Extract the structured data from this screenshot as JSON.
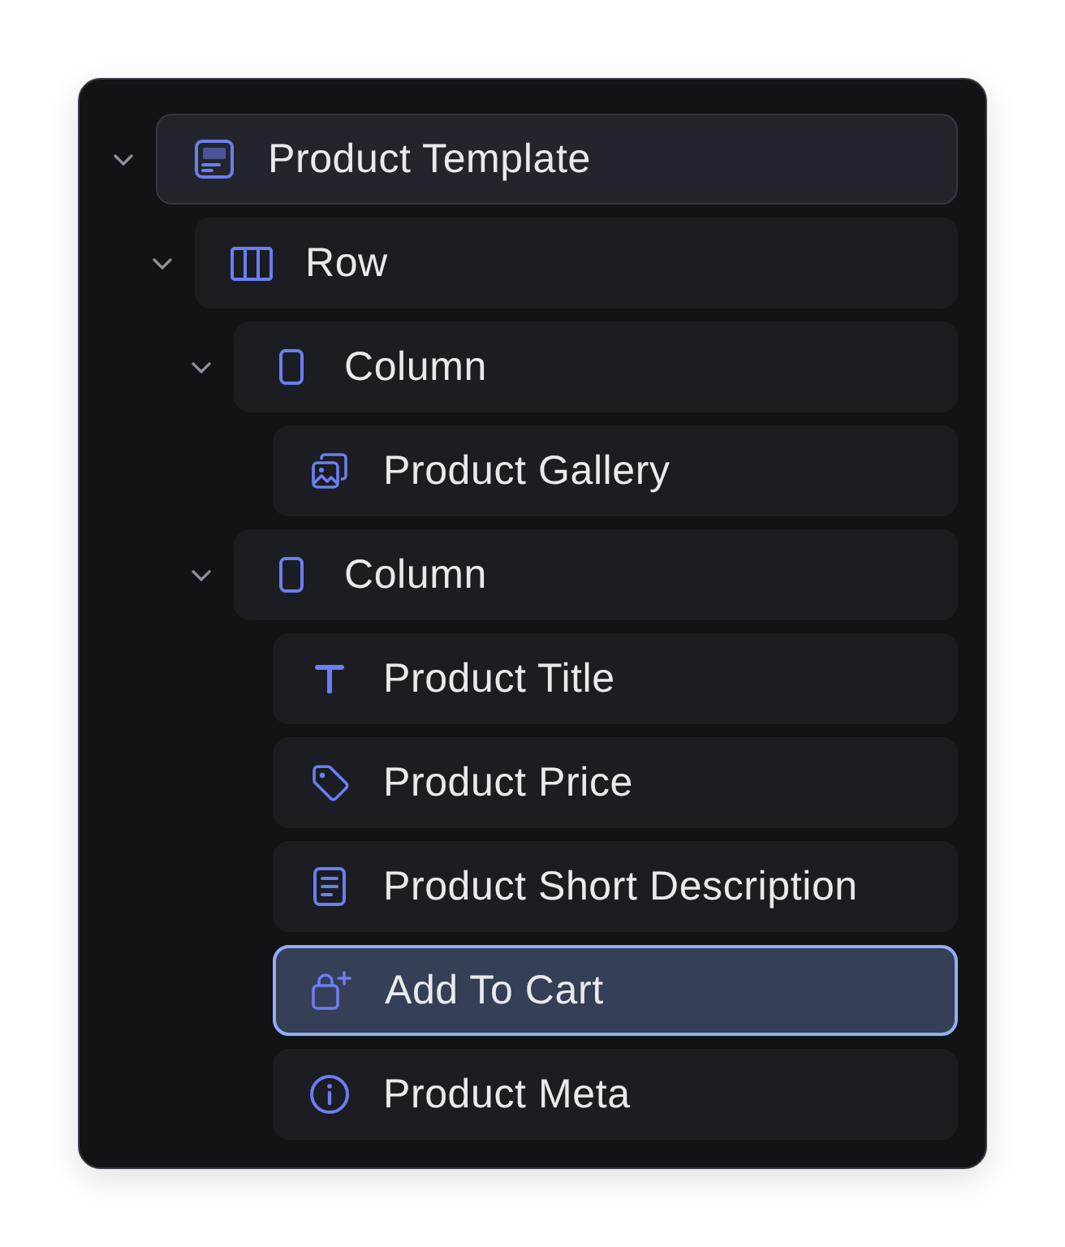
{
  "tree": [
    {
      "label": "Product Template",
      "kind": "template",
      "expanded": true,
      "selected": false,
      "children": [
        {
          "label": "Row",
          "kind": "row",
          "expanded": true,
          "selected": false,
          "children": [
            {
              "label": "Column",
              "kind": "column",
              "expanded": true,
              "selected": false,
              "children": [
                {
                  "label": "Product Gallery",
                  "kind": "gallery",
                  "selected": false
                }
              ]
            },
            {
              "label": "Column",
              "kind": "column",
              "expanded": true,
              "selected": false,
              "children": [
                {
                  "label": "Product Title",
                  "kind": "title",
                  "selected": false
                },
                {
                  "label": "Product Price",
                  "kind": "price",
                  "selected": false
                },
                {
                  "label": "Product Short Description",
                  "kind": "description",
                  "selected": false
                },
                {
                  "label": "Add To Cart",
                  "kind": "cart",
                  "selected": true
                },
                {
                  "label": "Product Meta",
                  "kind": "meta",
                  "selected": false
                }
              ]
            }
          ]
        }
      ]
    }
  ]
}
